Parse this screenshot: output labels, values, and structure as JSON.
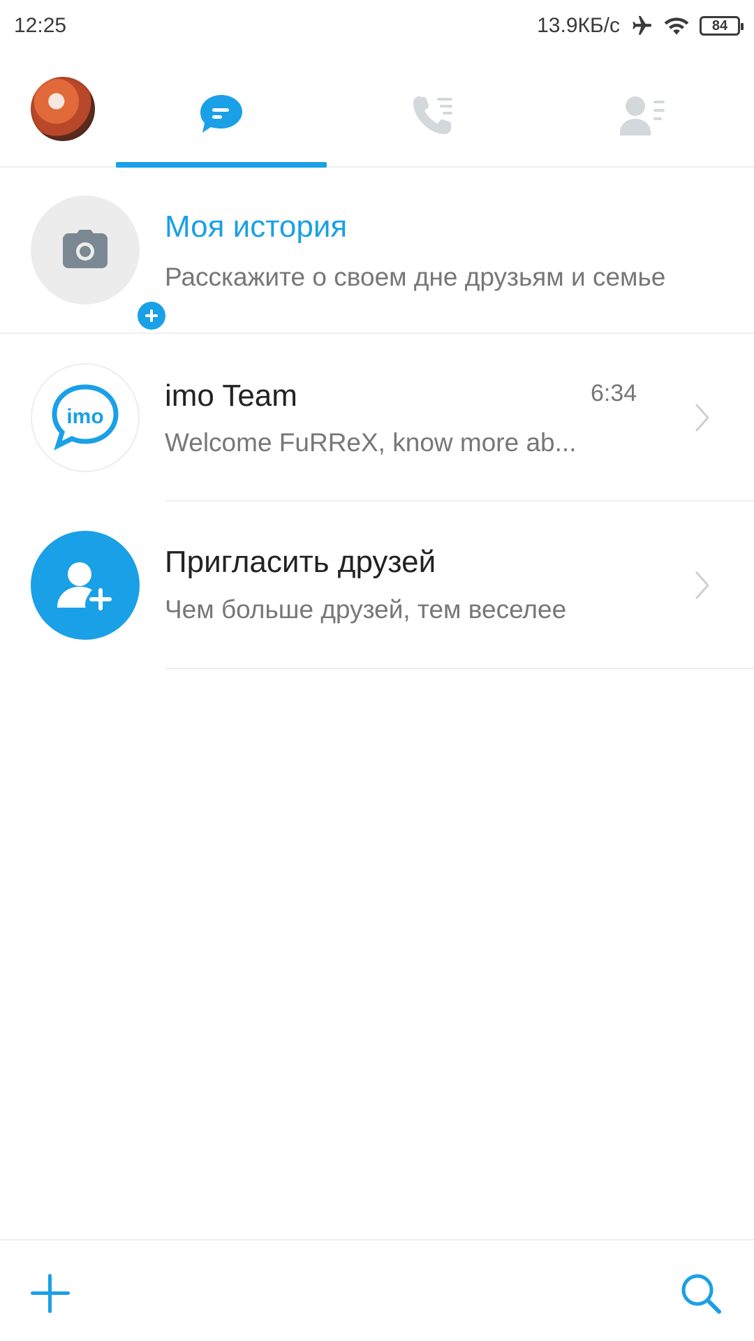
{
  "status_bar": {
    "time": "12:25",
    "network_speed": "13.9КБ/с",
    "battery_level": "84",
    "icons": [
      "airplane-icon",
      "wifi-icon",
      "battery-icon"
    ]
  },
  "tabs": {
    "active": "chats",
    "items": [
      {
        "id": "chats",
        "icon": "chat-bubble-icon"
      },
      {
        "id": "calls",
        "icon": "phone-list-icon"
      },
      {
        "id": "contacts",
        "icon": "contacts-list-icon"
      }
    ]
  },
  "story": {
    "title": "Моя история",
    "subtitle": "Расскажите о своем дне друзьям и семье"
  },
  "chats": [
    {
      "name": "imo Team",
      "time": "6:34",
      "preview": "Welcome FuRReX, know more ab...",
      "avatar_text": "imo"
    }
  ],
  "invite": {
    "title": "Пригласить друзей",
    "subtitle": "Чем больше друзей, тем веселее"
  },
  "colors": {
    "accent": "#1aa0e6",
    "muted_icon": "#d3d8dc",
    "text_primary": "#222222",
    "text_secondary": "#777777"
  }
}
